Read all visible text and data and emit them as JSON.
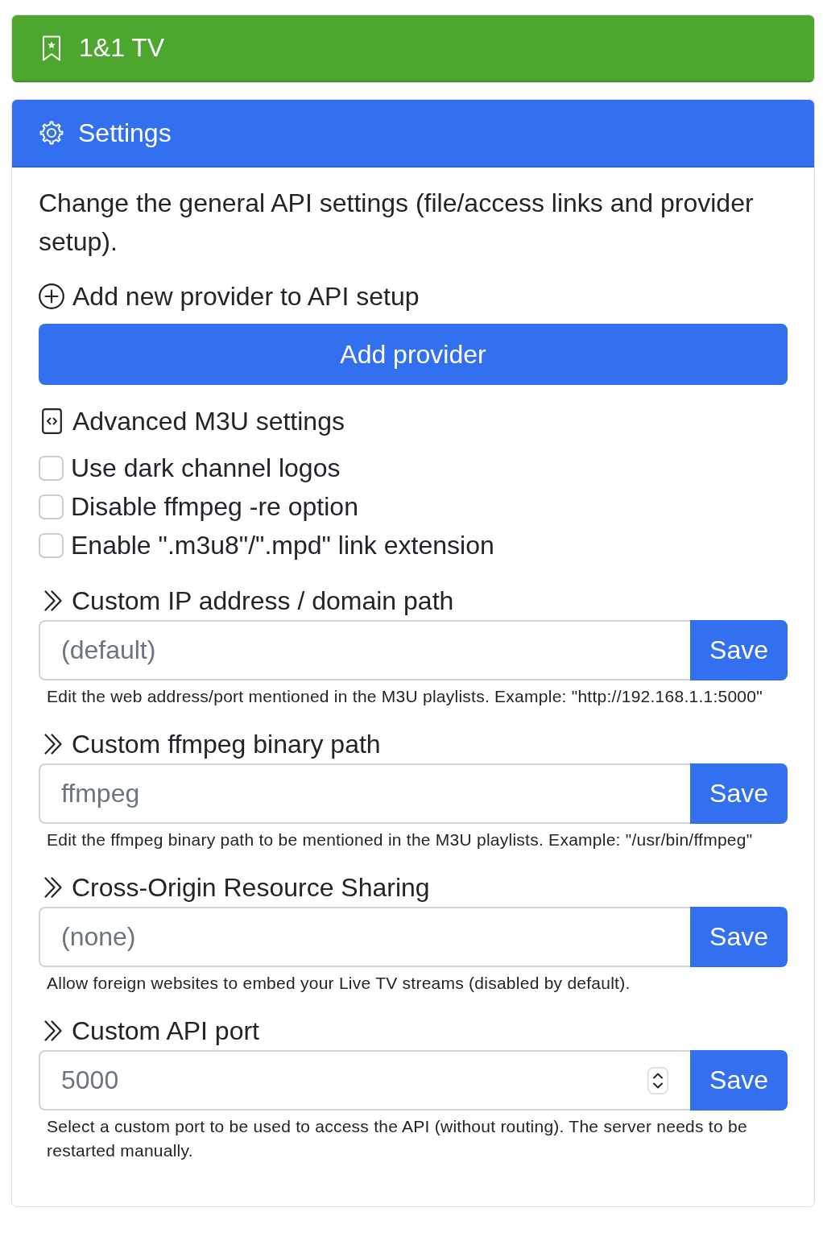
{
  "brand": {
    "title": "1&1 TV"
  },
  "settings": {
    "title": "Settings",
    "description": "Change the general API settings (file/access links and provider setup).",
    "add_provider": {
      "heading": "Add new provider to API setup",
      "button": "Add provider"
    },
    "advanced": {
      "heading": "Advanced M3U settings",
      "options": [
        {
          "label": "Use dark channel logos",
          "checked": false
        },
        {
          "label": "Disable ffmpeg -re option",
          "checked": false
        },
        {
          "label": "Enable \".m3u8\"/\".mpd\" link extension",
          "checked": false
        }
      ]
    },
    "fields": [
      {
        "heading": "Custom IP address / domain path",
        "kind": "text",
        "placeholder": "(default)",
        "button": "Save",
        "help": "Edit the web address/port mentioned in the M3U playlists. Example: \"http://192.168.1.1:5000\""
      },
      {
        "heading": "Custom ffmpeg binary path",
        "kind": "text",
        "placeholder": "ffmpeg",
        "button": "Save",
        "help": "Edit the ffmpeg binary path to be mentioned in the M3U playlists. Example: \"/usr/bin/ffmpeg\""
      },
      {
        "heading": "Cross-Origin Resource Sharing",
        "kind": "text",
        "placeholder": "(none)",
        "button": "Save",
        "help": "Allow foreign websites to embed your Live TV streams (disabled by default)."
      },
      {
        "heading": "Custom API port",
        "kind": "number",
        "placeholder": "5000",
        "button": "Save",
        "help": "Select a custom port to be used to access the API (without routing). The server needs to be restarted manually."
      }
    ]
  }
}
